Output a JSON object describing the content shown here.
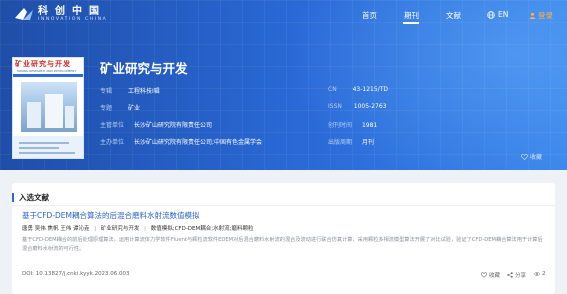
{
  "colors": {
    "brand": "#2a6ad8",
    "login": "#ffb23f",
    "link": "#2a62c9"
  },
  "logo": {
    "cn": "科创中国",
    "en": "INNOVATION CHINA"
  },
  "nav": {
    "home": "首页",
    "journal": "期刊",
    "article": "文献",
    "lang": "EN",
    "login": "登录"
  },
  "cover": {
    "title": "矿业研究与开发",
    "subtitle": "MINING RESEARCH AND DEVELOPMENT"
  },
  "journal": {
    "title": "矿业研究与开发",
    "fields": [
      {
        "key": "专辑",
        "value": "工程科技Ⅰ辑"
      },
      {
        "key": "专题",
        "value": "矿业"
      },
      {
        "key": "主管单位",
        "value": "长沙矿山研究院有限责任公司"
      },
      {
        "key": "主办单位",
        "value": "长沙矿山研究院有限责任公司;中国有色金属学会"
      },
      {
        "key": "CN",
        "value": "43-1215/TD"
      },
      {
        "key": "ISSN",
        "value": "1005-2763"
      },
      {
        "key": "创刊时间",
        "value": "1981"
      },
      {
        "key": "出版周期",
        "value": "月刊"
      }
    ],
    "favorite": "收藏"
  },
  "section": {
    "title": "入选文献"
  },
  "article": {
    "title": "基于CFD-DEM耦合算法的后混合磨料水射流数值模拟",
    "authors": "唐勇 吴伟 焦帆 王伟 谭沁垚",
    "journal": "矿业研究与开发",
    "keywords": "数值模拟;CFD-DEM耦合;水射流;磨料颗粒",
    "abstract": "基于CFD-DEM耦合的前后处理原理算法，运用计算流体力学软件Fluent与颗粒流软件EDEM对后混合磨料水射流的混合及流动进行联合仿真计算，采用颗粒多相流模型算法开展了对比试验，验证了CFD-DEM耦合算法用于计算后混合磨料水射流的可行性。",
    "doi": "DOI: 10.13827/j.cnki.kyyk.2023.06.003",
    "fav": "收藏",
    "share": "分享",
    "count": "2"
  }
}
